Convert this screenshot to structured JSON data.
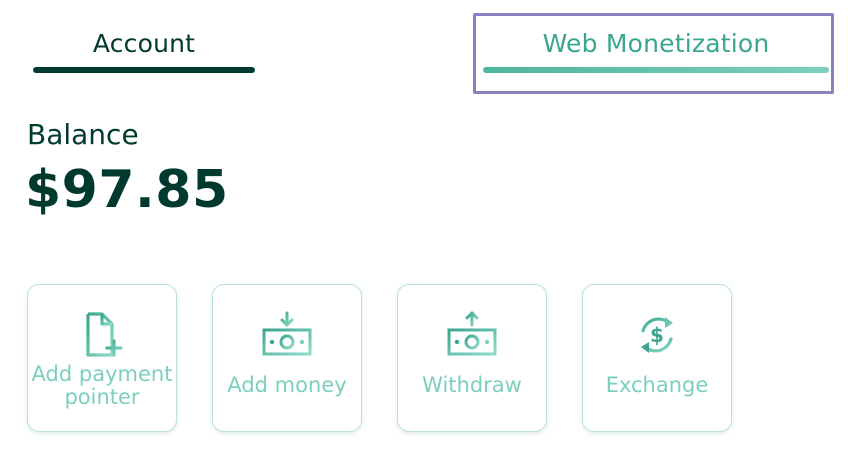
{
  "tabs": [
    {
      "label": "Account",
      "active": false
    },
    {
      "label": "Web Monetization",
      "active": true
    }
  ],
  "balance": {
    "label": "Balance",
    "value": "$97.85"
  },
  "actions": [
    {
      "label": "Add payment pointer",
      "icon": "file-plus-icon"
    },
    {
      "label": "Add money",
      "icon": "money-in-icon"
    },
    {
      "label": "Withdraw",
      "icon": "money-out-icon"
    },
    {
      "label": "Exchange",
      "icon": "exchange-icon"
    }
  ],
  "colors": {
    "dark": "#003a2f",
    "accent": "#3aa68f",
    "accent_light": "#7ccfbd",
    "highlight": "#8f7fc1"
  }
}
